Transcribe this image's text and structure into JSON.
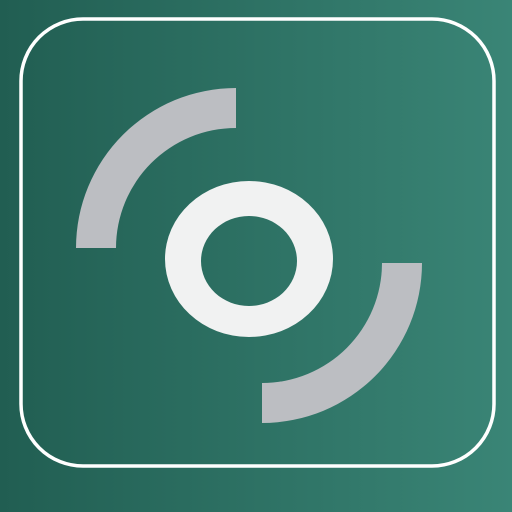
{
  "icon": {
    "name": "target-sync-app-icon",
    "colors": {
      "background_start": "#215E52",
      "background_end": "#3A8576",
      "frame_stroke": "#FFFFFF",
      "arc_fill": "#BCBEC2",
      "ring_fill": "#F1F2F2"
    }
  }
}
